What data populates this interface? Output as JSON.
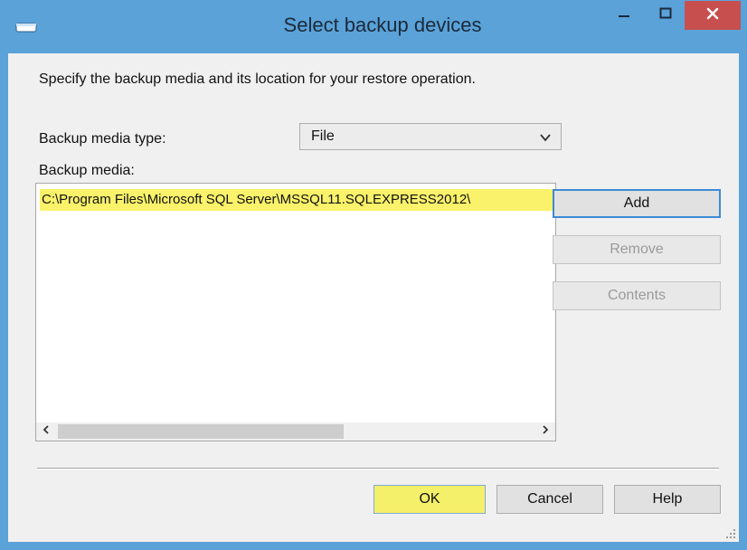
{
  "window": {
    "title": "Select backup devices"
  },
  "dialog": {
    "instruction": "Specify the backup media and its location for your restore operation.",
    "media_type_label": "Backup media type:",
    "media_type_value": "File",
    "media_label": "Backup media:",
    "media_items": [
      "C:\\Program Files\\Microsoft SQL Server\\MSSQL11.SQLEXPRESS2012\\"
    ]
  },
  "buttons": {
    "add": "Add",
    "remove": "Remove",
    "contents": "Contents",
    "ok": "OK",
    "cancel": "Cancel",
    "help": "Help"
  },
  "colors": {
    "titlebar": "#5aa2d8",
    "close": "#c7504f",
    "highlight": "#faf26a",
    "default_border": "#3c8ad6"
  },
  "icons": {
    "window": "window-icon",
    "minimize": "minimize-icon",
    "maximize": "maximize-icon",
    "close": "close-icon",
    "dropdown": "chevron-down-icon",
    "scroll_left": "chevron-left-icon",
    "scroll_right": "chevron-right-icon",
    "resize": "resize-grip-icon"
  }
}
